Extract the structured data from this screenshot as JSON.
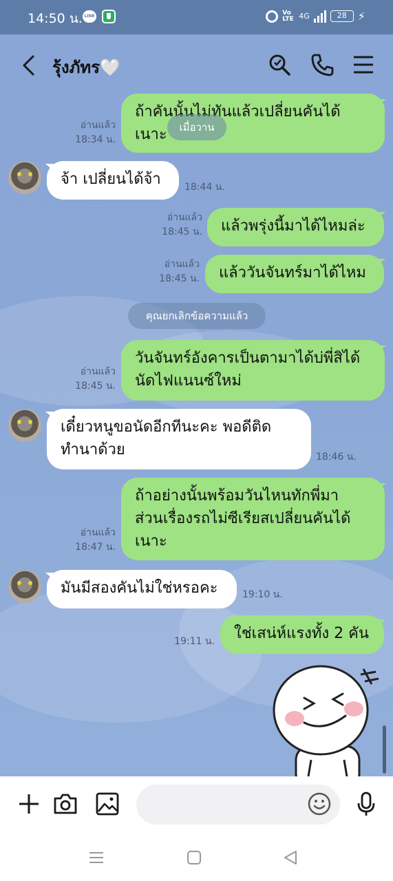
{
  "status_bar": {
    "time": "14:50 น.",
    "line_badge": "LINE",
    "volte": "Vo LTE",
    "network": "4G",
    "battery": "28"
  },
  "header": {
    "contact_name": "รุ้งภัทร🤍",
    "icons": [
      "back-icon",
      "search-icon",
      "phone-icon",
      "menu-icon"
    ]
  },
  "floating_date": "เมื่อวาน",
  "unsent_notice": "คุณยกเลิกข้อความแล้ว",
  "messages": [
    {
      "dir": "out",
      "text_lines": [
        "ถ้าคันนั้นไม่ทันแล้วเปลี่ยนคันได้",
        "เนาะ"
      ],
      "read": "อ่านแล้ว",
      "time": "18:34 น."
    },
    {
      "dir": "in",
      "text_lines": [
        "จ้า เปลี่ยนได้จ้า"
      ],
      "time": "18:44 น."
    },
    {
      "dir": "out",
      "text_lines": [
        "แล้วพรุ่งนี้มาได้ไหมล่ะ"
      ],
      "read": "อ่านแล้ว",
      "time": "18:45 น."
    },
    {
      "dir": "out",
      "text_lines": [
        "แล้ววันจันทร์มาได้ไหม"
      ],
      "read": "อ่านแล้ว",
      "time": "18:45 น."
    },
    {
      "dir": "out",
      "text_lines": [
        "วันจันทร์อังคารเป็นตามาได้บ่พี่สิได้",
        "นัดไฟแนนซ์ใหม่"
      ],
      "read": "อ่านแล้ว",
      "time": "18:45 น."
    },
    {
      "dir": "in",
      "text_lines": [
        "เดี๋ยวหนูขอนัดอีกทีนะคะ พอดีติด",
        "ทำนาด้วย"
      ],
      "time": "18:46 น."
    },
    {
      "dir": "out",
      "text_lines": [
        "ถ้าอย่างนั้นพร้อมวันไหนทักพี่มา",
        "ส่วนเรื่องรถไม่ซีเรียสเปลี่ยนคันได้",
        "เนาะ"
      ],
      "read": "อ่านแล้ว",
      "time": "18:47 น."
    },
    {
      "dir": "in",
      "text_lines": [
        "มันมีสองคันไม่ใช่หรอคะ"
      ],
      "time": "19:10 น."
    },
    {
      "dir": "out",
      "text_lines": [
        "ใช่เสน่ห์แรงทั้ง 2 คัน"
      ],
      "time": "19:11 น."
    }
  ],
  "sticker": "laughing-face-sticker",
  "input": {
    "placeholder": "",
    "icons": [
      "plus-icon",
      "camera-icon",
      "image-icon",
      "emoji-icon",
      "microphone-icon"
    ]
  },
  "colors": {
    "chat_bg": "#8ba7d6",
    "out_bubble": "#9ee283",
    "in_bubble": "#ffffff",
    "status_bar": "#5d7da8"
  }
}
